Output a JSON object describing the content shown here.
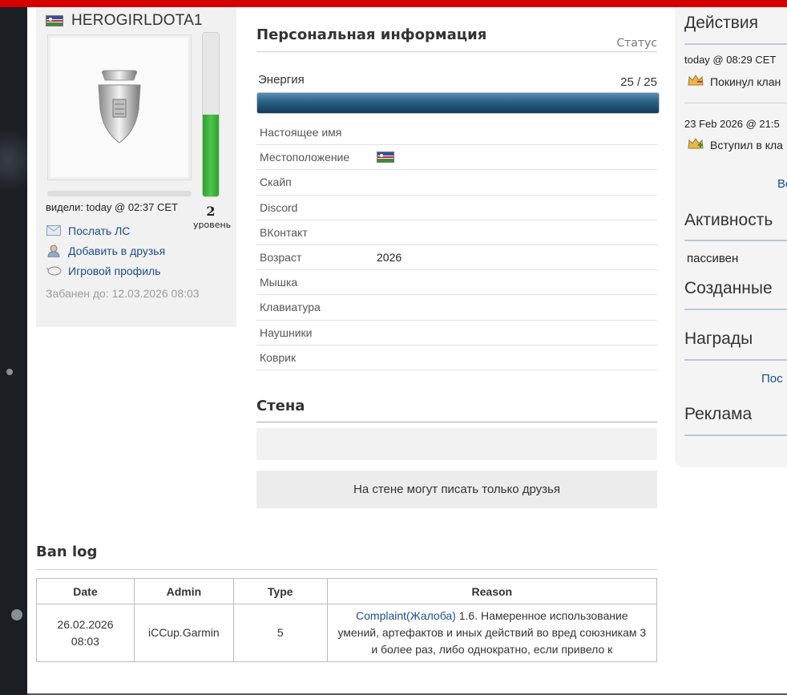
{
  "profile": {
    "nickname": "HEROGIRLDOTA1",
    "level": "2",
    "level_label": "уровень",
    "level_fill_fraction": 0.5,
    "last_seen": "видели: today @ 02:37 CET",
    "actions": {
      "send_pm": "Послать ЛС",
      "add_friend": "Добавить в друзья",
      "game_profile": "Игровой профиль"
    },
    "banned_until": "Забанен до: 12.03.2026 08:03"
  },
  "personal_info": {
    "title": "Персональная информация",
    "status_label": "Статус",
    "energy_label": "Энергия",
    "energy_value": "25 / 25",
    "energy_fraction": 1.0,
    "rows": [
      {
        "key": "Настоящее имя",
        "value": ""
      },
      {
        "key": "Местоположение",
        "value": ""
      },
      {
        "key": "Скайп",
        "value": ""
      },
      {
        "key": "Discord",
        "value": ""
      },
      {
        "key": "ВКонтакт",
        "value": ""
      },
      {
        "key": "Возраст",
        "value": "2026"
      },
      {
        "key": "Мышка",
        "value": ""
      },
      {
        "key": "Клавиатура",
        "value": ""
      },
      {
        "key": "Наушники",
        "value": ""
      },
      {
        "key": "Коврик",
        "value": ""
      }
    ]
  },
  "wall": {
    "title": "Стена",
    "note": "На стене могут писать только друзья"
  },
  "ban_log": {
    "title": "Ban log",
    "headers": [
      "Date",
      "Admin",
      "Type",
      "Reason"
    ],
    "rows": [
      {
        "date_line1": "26.02.2026",
        "date_line2": "08:03",
        "admin": "iCCup.Garmin",
        "type": "5",
        "reason_link": "Complaint(Жалоба)",
        "reason_text": " 1.6. Намеренное использование умений, артефактов и иных действий во вред союзникам 3 и более раз, либо однократно, если привело к"
      }
    ]
  },
  "sidebar": {
    "actions_title": "Действия",
    "events": [
      {
        "time": "today @ 08:29 CET",
        "text": "Покинул клан"
      },
      {
        "time": "23 Feb 2026 @ 21:5",
        "text": "Вступил в кла"
      }
    ],
    "more_link": "Вс",
    "activity_title": "Активность",
    "activity_value": "пассивен",
    "created_title": "Созданные",
    "awards_title": "Награды",
    "awards_link": "Пос",
    "ads_title": "Реклама"
  },
  "colors": {
    "top_bar": "#d40000",
    "link": "#1d4d8f",
    "level_fill": "#2aa52a",
    "energy_fill": "#2e6489"
  }
}
